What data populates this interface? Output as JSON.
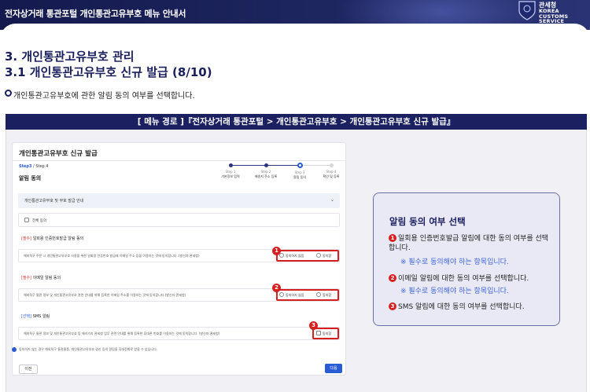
{
  "header": {
    "title": "전자상거래 통관포털 개인통관고유부호 메뉴 안내서",
    "brand_ko": "관세청",
    "brand_en_1": "KOREA CUSTOMS",
    "brand_en_2": "SERVICE"
  },
  "section": {
    "h1": "3. 개인통관고유부호 관리",
    "h2": "3.1 개인통관고유부호 신규 발급 (8/10)",
    "description": "개인통관고유부호에 관한 알림 동의 여부를 선택합니다."
  },
  "route": "[ 메뉴 경로 ]『전자상거래 통관포털 > 개인통관고유부호 > 개인통관고유부호 신규 발급』",
  "screen": {
    "title": "개인통관고유부호 신규 발급",
    "step_current": "Step3",
    "step_total": " / Step 4",
    "subtitle": "알림 동의",
    "steps": [
      {
        "label": "Step 1",
        "name": "기본정보 입력"
      },
      {
        "label": "Step 2",
        "name": "배송지 주소 등록"
      },
      {
        "label": "Step 3",
        "name": "알림 동의"
      },
      {
        "label": "Step 4",
        "name": "확인 및 등록"
      }
    ],
    "accordion": "개인통관고유부호 및 부호 발급 안내",
    "agree_all": "전체 동의",
    "sections": [
      {
        "tag": "[필수]",
        "title": " 일회용 인증번호발급 알림 동의",
        "text": "해외직구 주문 시 개인통관고유부호 사용을 위한 일회용 인증번호 발급에 이메일 주소 등을 이용하는 것에 동의합니다. (발신자:관세청)",
        "disagree": "동의하지 않음",
        "agree": "동의함"
      },
      {
        "tag": "[필수]",
        "title": " 이메일 알림 동의",
        "text": "해외직구 통관 정보 및 개인통관고유부호 관련 안내를 위해 등록한 이메일 주소를 이용하는 것에 동의합니다.(발신자:관세청)",
        "disagree": "동의하지 않음",
        "agree": "동의함"
      },
      {
        "tag": "[선택]",
        "title": " SMS 알림",
        "text": "해외직구 통관 정보 및 개인통관고유부호 등 에러가지 관세청 업무 관련 안내를 위해 등록한 휴대폰 번호를 이용하는 것에 동의합니다. (발신자:관세청)",
        "agree": "동의함"
      }
    ],
    "note": "동의하지 않는 경우 해외직구 통관물품, 개인통관고유부호 경신 등의 알림을 휴대전화로 받을 수 없습니다.",
    "prev": "이전",
    "next": "다음"
  },
  "panel": {
    "title": "알림 동의 여부 선택",
    "items": [
      {
        "num": "1",
        "text": "일회용 인증번호발급 알림에 대한 동의 여부를 선택합니다."
      },
      {
        "num": "2",
        "text": "이메일 알림에 대한 동의 여부를 선택합니다."
      },
      {
        "num": "3",
        "text": "SMS 알림에 대한 동의 여부를 선택합니다."
      }
    ],
    "required_note": "※ 필수로 동의해야 하는 항목입니다."
  },
  "callouts": [
    "1",
    "2",
    "3"
  ],
  "colors": {
    "navy": "#1b2060",
    "accent_red": "#d61f1f",
    "link_blue": "#3d63d8"
  }
}
